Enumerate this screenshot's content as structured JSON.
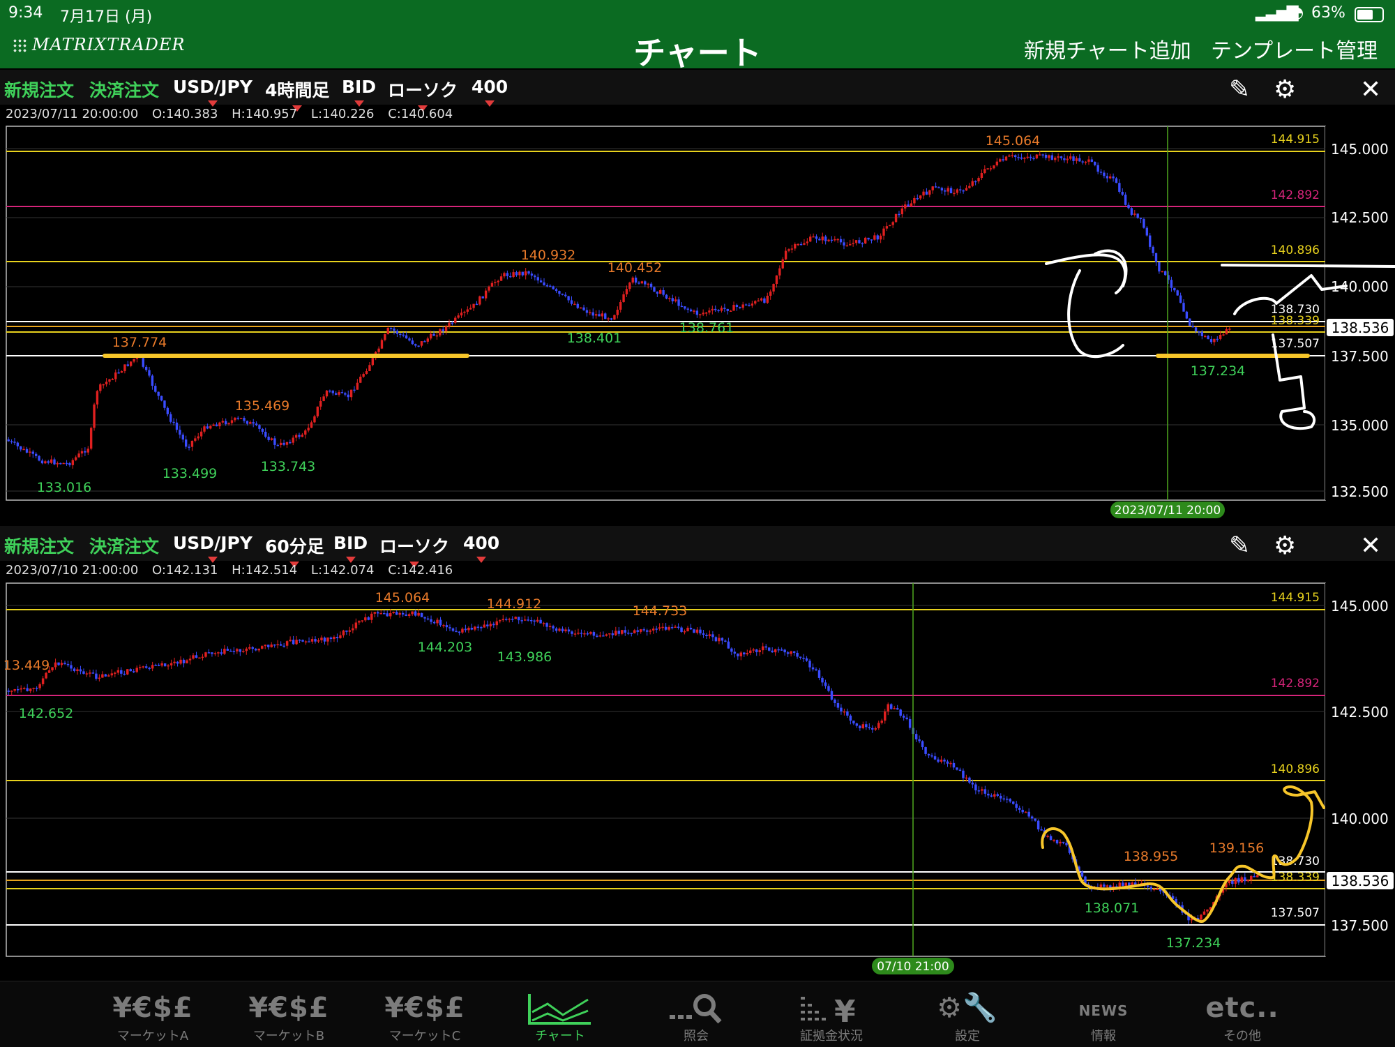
{
  "status": {
    "time": "9:34",
    "date": "7月17日 (月)",
    "battery": "63%"
  },
  "app": {
    "logo": "MATRIXTRADER",
    "title": "チャート",
    "add_chart": "新規チャート追加",
    "template": "テンプレート管理"
  },
  "chart1": {
    "toolbar": {
      "new_order": "新規注文",
      "settle_order": "決済注文",
      "pair": "USD/JPY",
      "timeframe": "4時間足",
      "price_type": "BID",
      "candle_type": "ローソク",
      "count": "400"
    },
    "ohlc": {
      "datetime": "2023/07/11 20:00:00",
      "open": "O:140.383",
      "high": "H:140.957",
      "low": "L:140.226",
      "close": "C:140.604"
    },
    "cursor_label": "2023/07/11 20:00",
    "y_ticks": [
      "145.000",
      "142.500",
      "140.000",
      "137.500",
      "135.000",
      "132.500"
    ],
    "current_price": "138.536",
    "line_labels": [
      "144.915",
      "142.892",
      "140.896",
      "138.730",
      "138.339",
      "137.507"
    ],
    "high_labels": [
      "137.774",
      "135.469",
      "140.932",
      "140.452",
      "145.064"
    ],
    "low_labels": [
      "133.016",
      "133.499",
      "133.743",
      "138.401",
      "138.761",
      "137.234"
    ]
  },
  "chart2": {
    "toolbar": {
      "new_order": "新規注文",
      "settle_order": "決済注文",
      "pair": "USD/JPY",
      "timeframe": "60分足",
      "price_type": "BID",
      "candle_type": "ローソク",
      "count": "400"
    },
    "ohlc": {
      "datetime": "2023/07/10 21:00:00",
      "open": "O:142.131",
      "high": "H:142.514",
      "low": "L:142.074",
      "close": "C:142.416"
    },
    "cursor_label": "07/10 21:00",
    "y_ticks": [
      "145.000",
      "142.500",
      "140.000",
      "137.500"
    ],
    "current_price": "138.536",
    "line_labels": [
      "144.915",
      "142.892",
      "140.896",
      "138.730",
      "138.339",
      "137.507"
    ],
    "high_labels": [
      "13.449",
      "145.064",
      "144.912",
      "144.733",
      "138.955",
      "139.156"
    ],
    "low_labels": [
      "142.652",
      "144.203",
      "143.986",
      "138.071",
      "137.234"
    ]
  },
  "tabs": [
    {
      "label": "マーケットA",
      "icon": "¥€$£"
    },
    {
      "label": "マーケットB",
      "icon": "¥€$£"
    },
    {
      "label": "マーケットC",
      "icon": "¥€$£"
    },
    {
      "label": "チャート",
      "icon": "chart-icon"
    },
    {
      "label": "照会",
      "icon": "search-icon"
    },
    {
      "label": "証拠金状況",
      "icon": "margin-icon"
    },
    {
      "label": "設定",
      "icon": "settings-icon"
    },
    {
      "label": "情報",
      "icon": "NEWS"
    },
    {
      "label": "その他",
      "icon": "etc.."
    }
  ],
  "colors": {
    "up": "#e02020",
    "down": "#3a4cff",
    "brand_green": "#0b6b22",
    "accent_green": "#3fd15a",
    "level_yellow": "#e8d21d",
    "level_magenta": "#d6247a",
    "high_label": "#e87a2a",
    "low_label": "#3fd15a",
    "annotation_yellow": "#f7c62a"
  }
}
